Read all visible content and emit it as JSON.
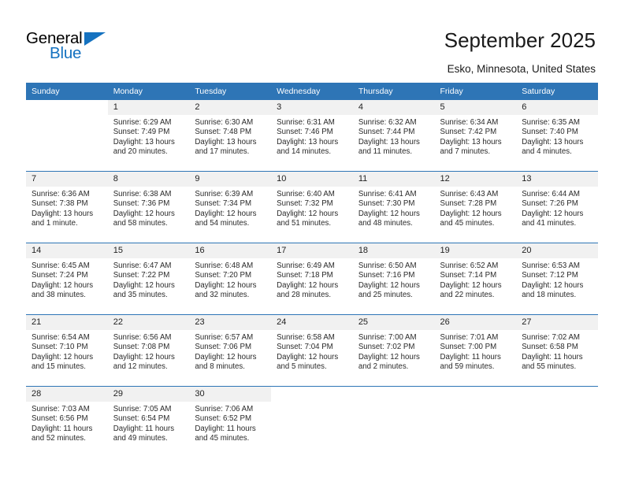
{
  "brand": {
    "name_top": "General",
    "name_bottom": "Blue",
    "color_primary": "#1572c0",
    "color_header": "#2e75b6"
  },
  "header": {
    "title": "September 2025",
    "subtitle": "Esko, Minnesota, United States"
  },
  "calendar": {
    "weekday_headers": [
      "Sunday",
      "Monday",
      "Tuesday",
      "Wednesday",
      "Thursday",
      "Friday",
      "Saturday"
    ],
    "weeks": [
      [
        {
          "day": "",
          "blank": true
        },
        {
          "day": "1",
          "sunrise": "Sunrise: 6:29 AM",
          "sunset": "Sunset: 7:49 PM",
          "daylight": "Daylight: 13 hours and 20 minutes."
        },
        {
          "day": "2",
          "sunrise": "Sunrise: 6:30 AM",
          "sunset": "Sunset: 7:48 PM",
          "daylight": "Daylight: 13 hours and 17 minutes."
        },
        {
          "day": "3",
          "sunrise": "Sunrise: 6:31 AM",
          "sunset": "Sunset: 7:46 PM",
          "daylight": "Daylight: 13 hours and 14 minutes."
        },
        {
          "day": "4",
          "sunrise": "Sunrise: 6:32 AM",
          "sunset": "Sunset: 7:44 PM",
          "daylight": "Daylight: 13 hours and 11 minutes."
        },
        {
          "day": "5",
          "sunrise": "Sunrise: 6:34 AM",
          "sunset": "Sunset: 7:42 PM",
          "daylight": "Daylight: 13 hours and 7 minutes."
        },
        {
          "day": "6",
          "sunrise": "Sunrise: 6:35 AM",
          "sunset": "Sunset: 7:40 PM",
          "daylight": "Daylight: 13 hours and 4 minutes."
        }
      ],
      [
        {
          "day": "7",
          "sunrise": "Sunrise: 6:36 AM",
          "sunset": "Sunset: 7:38 PM",
          "daylight": "Daylight: 13 hours and 1 minute."
        },
        {
          "day": "8",
          "sunrise": "Sunrise: 6:38 AM",
          "sunset": "Sunset: 7:36 PM",
          "daylight": "Daylight: 12 hours and 58 minutes."
        },
        {
          "day": "9",
          "sunrise": "Sunrise: 6:39 AM",
          "sunset": "Sunset: 7:34 PM",
          "daylight": "Daylight: 12 hours and 54 minutes."
        },
        {
          "day": "10",
          "sunrise": "Sunrise: 6:40 AM",
          "sunset": "Sunset: 7:32 PM",
          "daylight": "Daylight: 12 hours and 51 minutes."
        },
        {
          "day": "11",
          "sunrise": "Sunrise: 6:41 AM",
          "sunset": "Sunset: 7:30 PM",
          "daylight": "Daylight: 12 hours and 48 minutes."
        },
        {
          "day": "12",
          "sunrise": "Sunrise: 6:43 AM",
          "sunset": "Sunset: 7:28 PM",
          "daylight": "Daylight: 12 hours and 45 minutes."
        },
        {
          "day": "13",
          "sunrise": "Sunrise: 6:44 AM",
          "sunset": "Sunset: 7:26 PM",
          "daylight": "Daylight: 12 hours and 41 minutes."
        }
      ],
      [
        {
          "day": "14",
          "sunrise": "Sunrise: 6:45 AM",
          "sunset": "Sunset: 7:24 PM",
          "daylight": "Daylight: 12 hours and 38 minutes."
        },
        {
          "day": "15",
          "sunrise": "Sunrise: 6:47 AM",
          "sunset": "Sunset: 7:22 PM",
          "daylight": "Daylight: 12 hours and 35 minutes."
        },
        {
          "day": "16",
          "sunrise": "Sunrise: 6:48 AM",
          "sunset": "Sunset: 7:20 PM",
          "daylight": "Daylight: 12 hours and 32 minutes."
        },
        {
          "day": "17",
          "sunrise": "Sunrise: 6:49 AM",
          "sunset": "Sunset: 7:18 PM",
          "daylight": "Daylight: 12 hours and 28 minutes."
        },
        {
          "day": "18",
          "sunrise": "Sunrise: 6:50 AM",
          "sunset": "Sunset: 7:16 PM",
          "daylight": "Daylight: 12 hours and 25 minutes."
        },
        {
          "day": "19",
          "sunrise": "Sunrise: 6:52 AM",
          "sunset": "Sunset: 7:14 PM",
          "daylight": "Daylight: 12 hours and 22 minutes."
        },
        {
          "day": "20",
          "sunrise": "Sunrise: 6:53 AM",
          "sunset": "Sunset: 7:12 PM",
          "daylight": "Daylight: 12 hours and 18 minutes."
        }
      ],
      [
        {
          "day": "21",
          "sunrise": "Sunrise: 6:54 AM",
          "sunset": "Sunset: 7:10 PM",
          "daylight": "Daylight: 12 hours and 15 minutes."
        },
        {
          "day": "22",
          "sunrise": "Sunrise: 6:56 AM",
          "sunset": "Sunset: 7:08 PM",
          "daylight": "Daylight: 12 hours and 12 minutes."
        },
        {
          "day": "23",
          "sunrise": "Sunrise: 6:57 AM",
          "sunset": "Sunset: 7:06 PM",
          "daylight": "Daylight: 12 hours and 8 minutes."
        },
        {
          "day": "24",
          "sunrise": "Sunrise: 6:58 AM",
          "sunset": "Sunset: 7:04 PM",
          "daylight": "Daylight: 12 hours and 5 minutes."
        },
        {
          "day": "25",
          "sunrise": "Sunrise: 7:00 AM",
          "sunset": "Sunset: 7:02 PM",
          "daylight": "Daylight: 12 hours and 2 minutes."
        },
        {
          "day": "26",
          "sunrise": "Sunrise: 7:01 AM",
          "sunset": "Sunset: 7:00 PM",
          "daylight": "Daylight: 11 hours and 59 minutes."
        },
        {
          "day": "27",
          "sunrise": "Sunrise: 7:02 AM",
          "sunset": "Sunset: 6:58 PM",
          "daylight": "Daylight: 11 hours and 55 minutes."
        }
      ],
      [
        {
          "day": "28",
          "sunrise": "Sunrise: 7:03 AM",
          "sunset": "Sunset: 6:56 PM",
          "daylight": "Daylight: 11 hours and 52 minutes."
        },
        {
          "day": "29",
          "sunrise": "Sunrise: 7:05 AM",
          "sunset": "Sunset: 6:54 PM",
          "daylight": "Daylight: 11 hours and 49 minutes."
        },
        {
          "day": "30",
          "sunrise": "Sunrise: 7:06 AM",
          "sunset": "Sunset: 6:52 PM",
          "daylight": "Daylight: 11 hours and 45 minutes."
        },
        {
          "day": "",
          "blank": true
        },
        {
          "day": "",
          "blank": true
        },
        {
          "day": "",
          "blank": true
        },
        {
          "day": "",
          "blank": true
        }
      ]
    ]
  }
}
